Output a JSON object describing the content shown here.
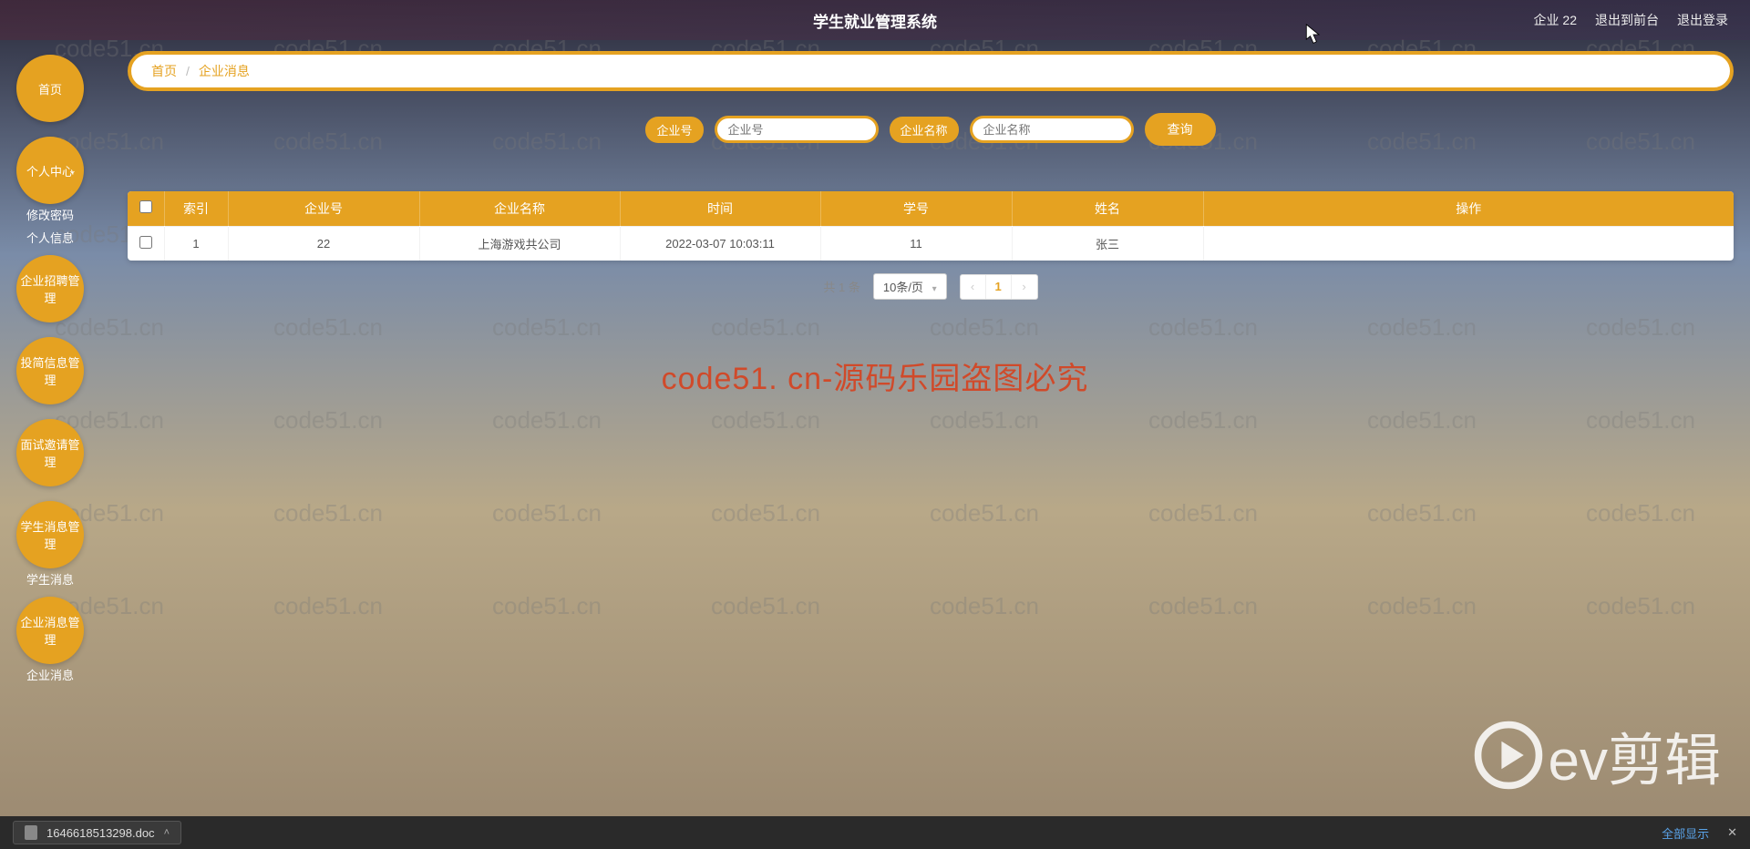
{
  "watermark_text": "code51.cn",
  "center_watermark": "code51. cn-源码乐园盗图必究",
  "header": {
    "title": "学生就业管理系统",
    "user": "企业 22",
    "to_front": "退出到前台",
    "logout": "退出登录"
  },
  "sidebar": {
    "home": "首页",
    "personal": "个人中心",
    "change_pwd": "修改密码",
    "personal_info": "个人信息",
    "recruit_mgmt": "企业招聘管理",
    "resume_mgmt": "投简信息管理",
    "interview_mgmt": "面试邀请管理",
    "student_msg_mgmt": "学生消息管理",
    "student_msg": "学生消息",
    "company_msg_mgmt": "企业消息管理",
    "company_msg": "企业消息"
  },
  "breadcrumb": {
    "home": "首页",
    "current": "企业消息"
  },
  "search": {
    "label_id": "企业号",
    "placeholder_id": "企业号",
    "label_name": "企业名称",
    "placeholder_name": "企业名称",
    "btn": "查询"
  },
  "table": {
    "headers": [
      "索引",
      "企业号",
      "企业名称",
      "时间",
      "学号",
      "姓名",
      "操作"
    ],
    "rows": [
      {
        "index": "1",
        "company_id": "22",
        "company_name": "上海游戏共公司",
        "time": "2022-03-07 10:03:11",
        "student_id": "11",
        "student_name": "张三",
        "action": ""
      }
    ]
  },
  "pagination": {
    "summary": "共 1 条",
    "page_size": "10条/页",
    "current": "1"
  },
  "taskbar": {
    "download": "1646618513298.doc",
    "show_all": "全部显示"
  },
  "brand": "ev剪辑"
}
